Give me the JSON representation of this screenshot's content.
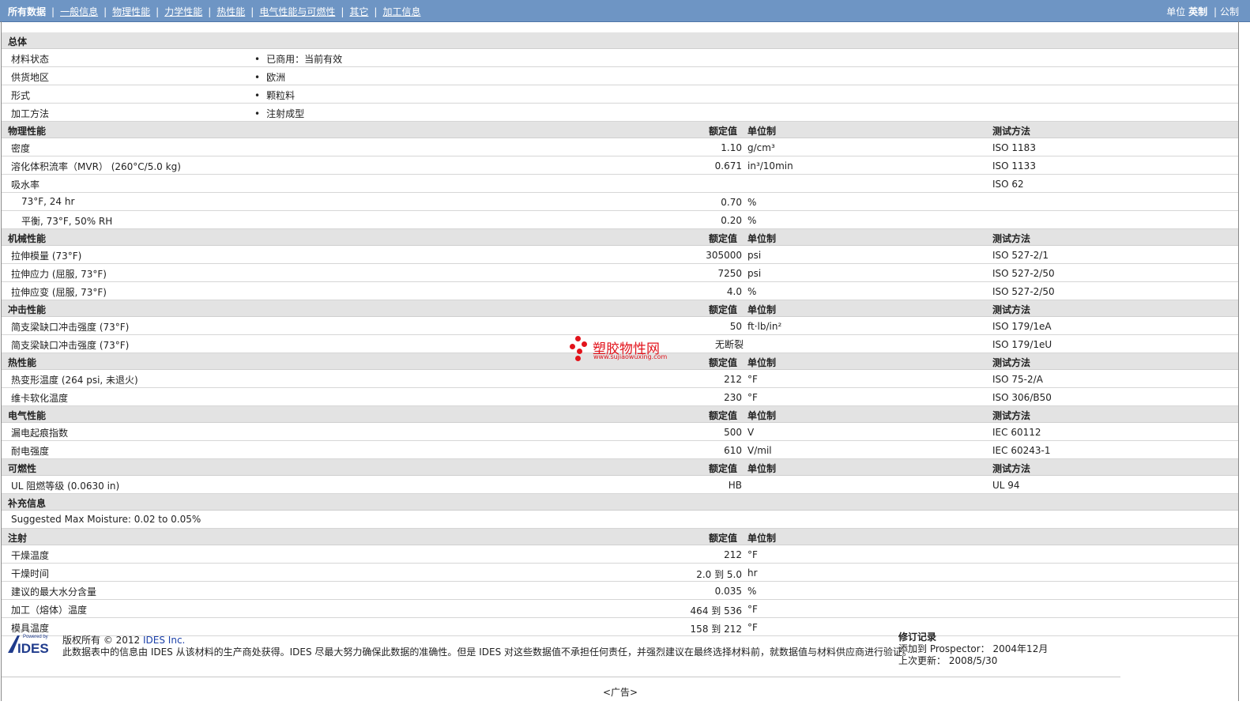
{
  "nav": {
    "items": [
      "所有数据",
      "一般信息",
      "物理性能",
      "力学性能",
      "热性能",
      "电气性能与可燃性",
      "其它",
      "加工信息"
    ],
    "units_label": "单位",
    "unit_english": "英制",
    "unit_metric": "公制"
  },
  "sections": {
    "general": {
      "title": "总体",
      "rows": [
        {
          "label": "材料状态",
          "value": "已商用：当前有效"
        },
        {
          "label": "供货地区",
          "value": "欧洲"
        },
        {
          "label": "形式",
          "value": "颗粒料"
        },
        {
          "label": "加工方法",
          "value": "注射成型"
        }
      ]
    },
    "headers": {
      "nominal": "额定值",
      "unit": "单位制",
      "method": "测试方法"
    },
    "physical": {
      "title": "物理性能",
      "rows": [
        {
          "label": "密度",
          "value": "1.10",
          "unit": "g/cm³",
          "method": "ISO 1183"
        },
        {
          "label": "溶化体积流率（MVR） (260°C/5.0 kg)",
          "value": "0.671",
          "unit": "in³/10min",
          "method": "ISO 1133"
        },
        {
          "label": "吸水率",
          "value": "",
          "unit": "",
          "method": "ISO 62"
        },
        {
          "label": "73°F, 24 hr",
          "value": "0.70",
          "unit": "%",
          "method": ""
        },
        {
          "label": "平衡, 73°F, 50% RH",
          "value": "0.20",
          "unit": "%",
          "method": ""
        }
      ]
    },
    "mechanical": {
      "title": "机械性能",
      "rows": [
        {
          "label": "拉伸模量 (73°F)",
          "value": "305000",
          "unit": "psi",
          "method": "ISO 527-2/1"
        },
        {
          "label": "拉伸应力 (屈服, 73°F)",
          "value": "7250",
          "unit": "psi",
          "method": "ISO 527-2/50"
        },
        {
          "label": "拉伸应变 (屈服, 73°F)",
          "value": "4.0",
          "unit": "%",
          "method": "ISO 527-2/50"
        }
      ]
    },
    "impact": {
      "title": "冲击性能",
      "rows": [
        {
          "label": "简支梁缺口冲击强度 (73°F)",
          "value": "50",
          "unit": "ft·lb/in²",
          "method": "ISO 179/1eA"
        },
        {
          "label": "简支梁缺口冲击强度 (73°F)",
          "value": "无断裂",
          "unit": "",
          "method": "ISO 179/1eU"
        }
      ]
    },
    "thermal": {
      "title": "热性能",
      "rows": [
        {
          "label": "热变形温度 (264 psi, 未退火)",
          "value": "212",
          "unit": "°F",
          "method": "ISO 75-2/A"
        },
        {
          "label": "维卡软化温度",
          "value": "230",
          "unit": "°F",
          "method": "ISO 306/B50"
        }
      ]
    },
    "electrical": {
      "title": "电气性能",
      "rows": [
        {
          "label": "漏电起痕指数",
          "value": "500",
          "unit": "V",
          "method": "IEC 60112"
        },
        {
          "label": "耐电强度",
          "value": "610",
          "unit": "V/mil",
          "method": "IEC 60243-1"
        }
      ]
    },
    "flammability": {
      "title": "可燃性",
      "rows": [
        {
          "label": "UL 阻燃等级 (0.0630 in)",
          "value": "HB",
          "unit": "",
          "method": "UL 94"
        }
      ]
    },
    "supplement": {
      "title": "补充信息",
      "text": "Suggested Max Moisture: 0.02 to 0.05%"
    },
    "injection": {
      "title": "注射",
      "rows": [
        {
          "label": "干燥温度",
          "value": "212",
          "unit": "°F"
        },
        {
          "label": "干燥时间",
          "value": "2.0 到  5.0",
          "unit": "hr"
        },
        {
          "label": "建议的最大水分含量",
          "value": "0.035",
          "unit": "%"
        },
        {
          "label": "加工（熔体）温度",
          "value": "464 到  536",
          "unit": "°F"
        },
        {
          "label": "模具温度",
          "value": "158 到  212",
          "unit": "°F"
        }
      ]
    }
  },
  "watermark": {
    "text": "塑胶物性网",
    "url": "www.sujiaowuxing.com",
    "color": "#e2131b"
  },
  "footer": {
    "logo_text": "IDES",
    "logo_powered": "Powered by",
    "copyright_prefix": "版权所有 © 2012",
    "company": "IDES Inc.",
    "disclaimer": "此数据表中的信息由 IDES 从该材料的生产商处获得。IDES 尽最大努力确保此数据的准确性。但是 IDES 对这些数据值不承担任何责任，并强烈建议在最终选择材料前，就数据值与材料供应商进行验证。",
    "revision_title": "修订记录",
    "added_label": "添加到 Prospector：",
    "added_value": "2004年12月",
    "updated_label": "上次更新：",
    "updated_value": "2008/5/30",
    "ad": "<广告>"
  }
}
